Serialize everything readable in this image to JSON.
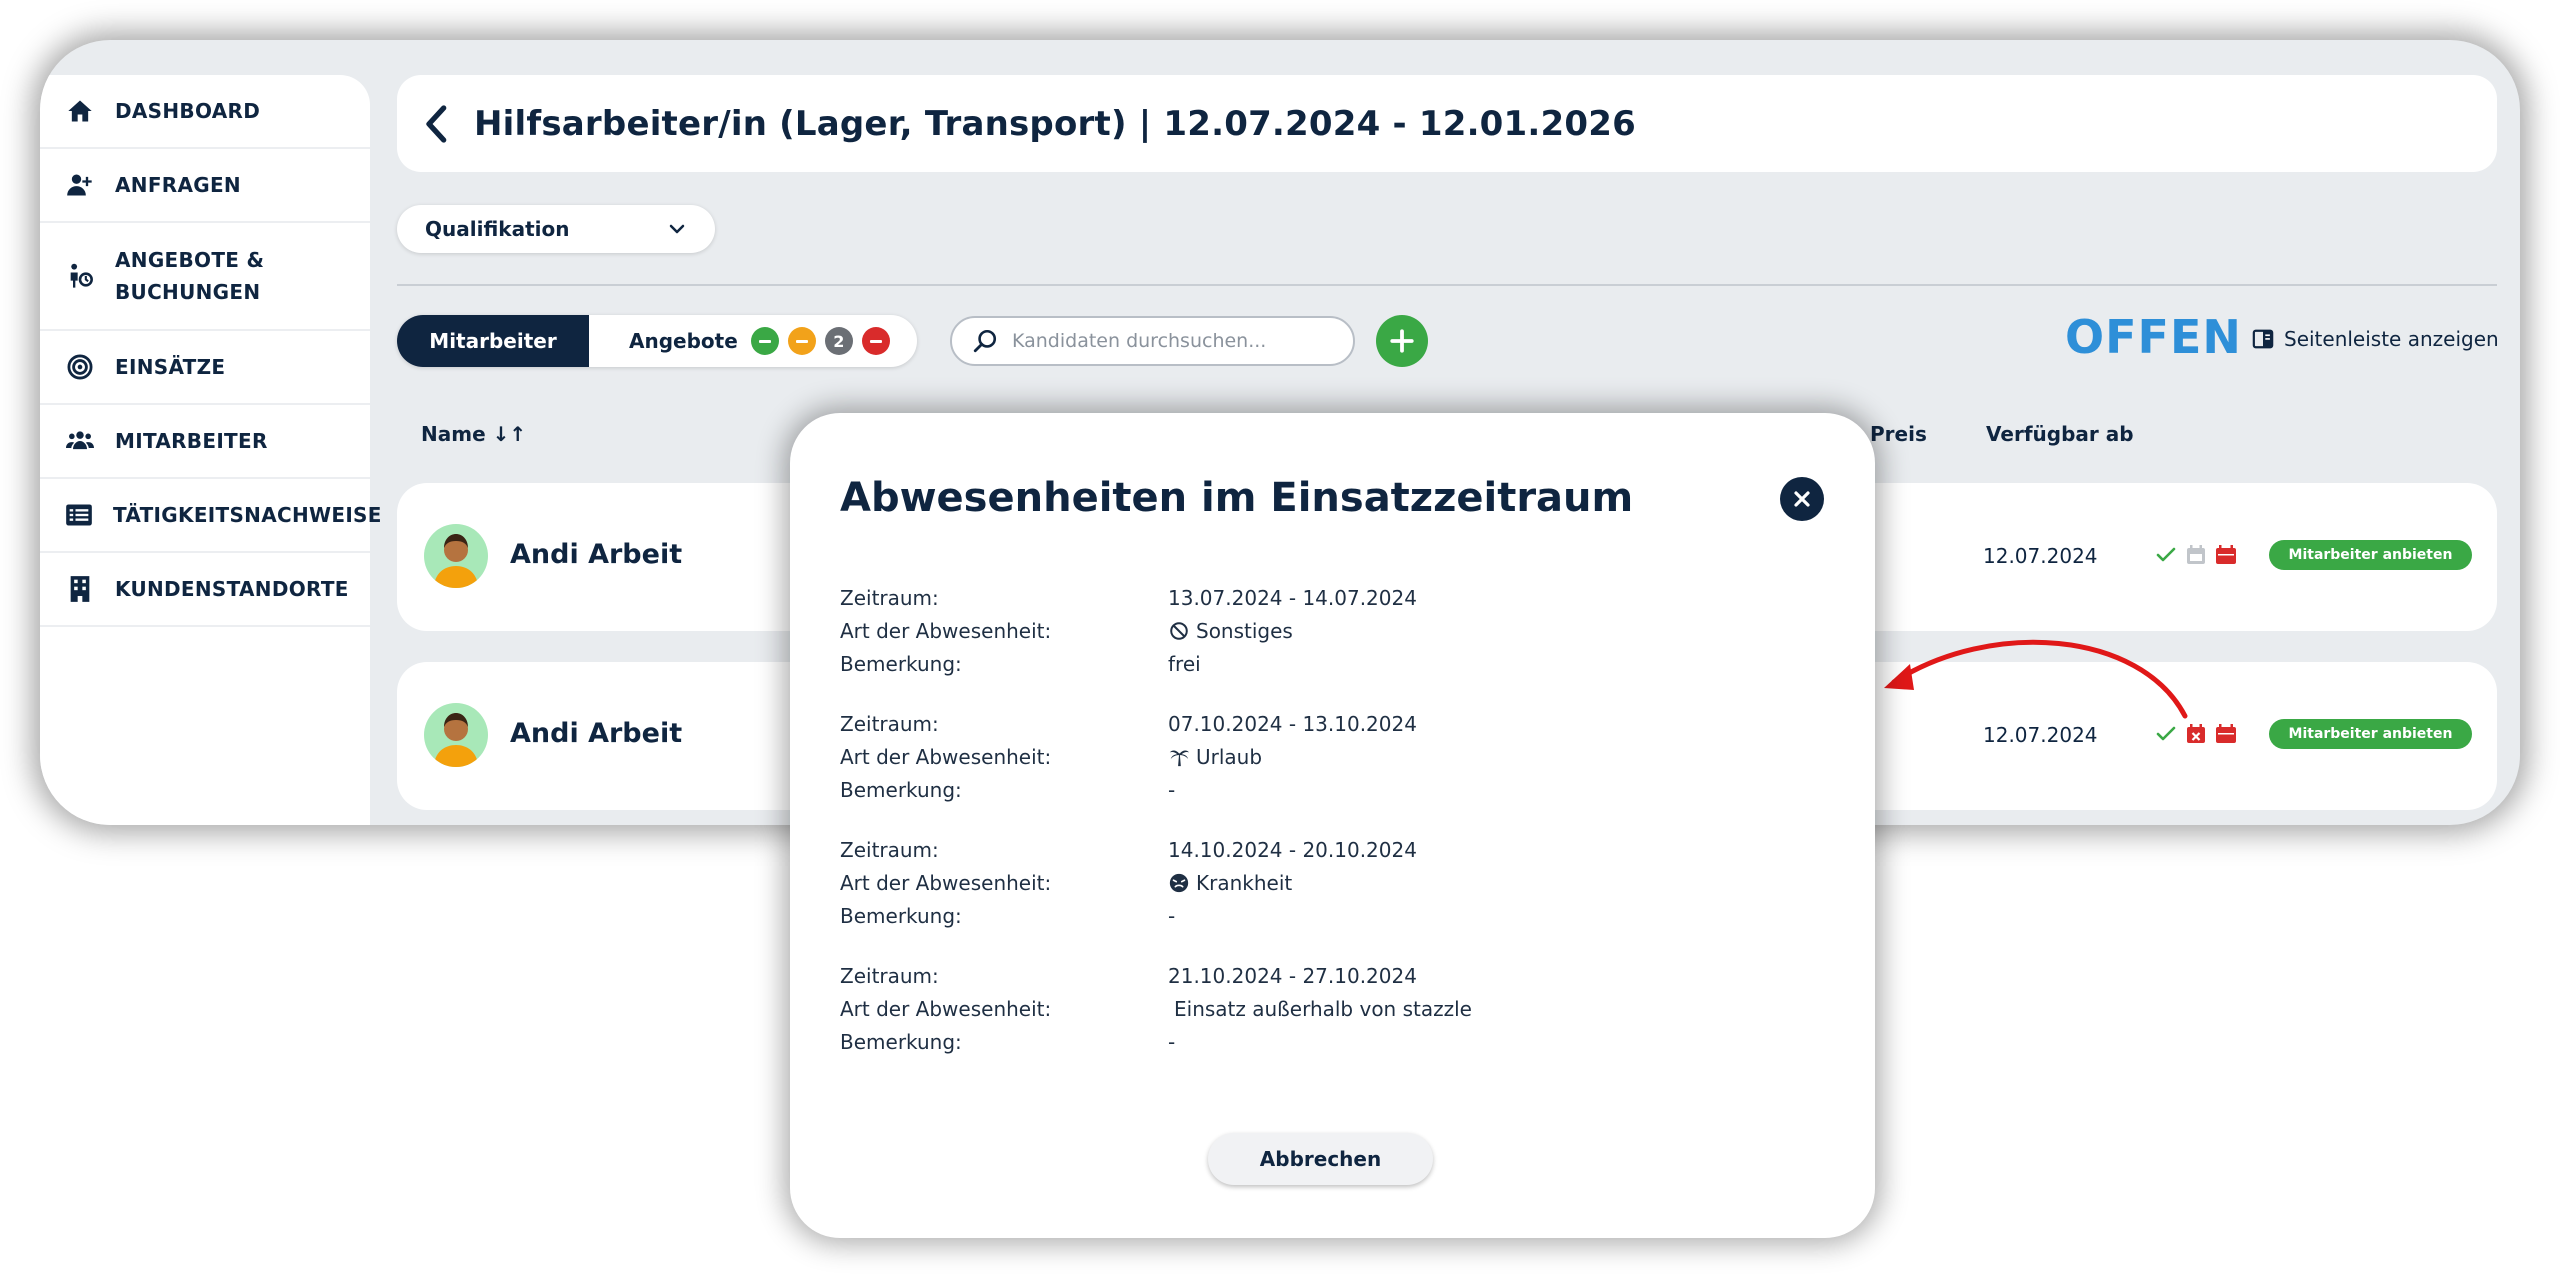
{
  "sidebar": {
    "items": [
      {
        "label": "DASHBOARD",
        "icon": "home-icon"
      },
      {
        "label": "ANFRAGEN",
        "icon": "user-plus-icon"
      },
      {
        "label": "ANGEBOTE &\nBUCHUNGEN",
        "icon": "person-offer-icon"
      },
      {
        "label": "EINSÄTZE",
        "icon": "target-icon"
      },
      {
        "label": "MITARBEITER",
        "icon": "users-icon"
      },
      {
        "label": "TÄTIGKEITSNACHWEISE",
        "icon": "list-icon"
      },
      {
        "label": "KUNDENSTANDORTE",
        "icon": "building-icon"
      }
    ]
  },
  "header": {
    "title": "Hilfsarbeiter/in (Lager, Transport) | 12.07.2024 - 12.01.2026"
  },
  "filter": {
    "qualification_label": "Qualifikation"
  },
  "tabs": {
    "mitarbeiter": "Mitarbeiter",
    "angebote": "Angebote",
    "badges": [
      {
        "color": "#3aa845",
        "value": ""
      },
      {
        "color": "#f2a21a",
        "value": ""
      },
      {
        "color": "#6b6f75",
        "value": "2"
      },
      {
        "color": "#d92b2b",
        "value": ""
      }
    ]
  },
  "search": {
    "placeholder": "Kandidaten durchsuchen...",
    "value": ""
  },
  "status": "OFFEN",
  "sidebar_toggle_label": "Seitenleiste anzeigen",
  "columns": {
    "name": "Name ↓↑",
    "preis": "Preis",
    "available": "Verfügbar ab"
  },
  "candidates": [
    {
      "name": "Andi Arbeit",
      "available": "12.07.2024",
      "action": "Mitarbeiter anbieten"
    },
    {
      "name": "Andi Arbeit",
      "available": "12.07.2024",
      "action": "Mitarbeiter anbieten"
    }
  ],
  "colors": {
    "primary": "#0f2540",
    "accent_green": "#3aa845",
    "status_blue": "#2e8fd8",
    "alert_red": "#d92b2b"
  },
  "modal": {
    "title": "Abwesenheiten im Einsatzzeitraum",
    "labels": {
      "period": "Zeitraum:",
      "type": "Art der Abwesenheit:",
      "note": "Bemerkung:"
    },
    "absences": [
      {
        "period": "13.07.2024 - 14.07.2024",
        "type": "Sonstiges",
        "icon": "ban-icon",
        "note": "frei"
      },
      {
        "period": "07.10.2024 - 13.10.2024",
        "type": "Urlaub",
        "icon": "palm-tree-icon",
        "note": "-"
      },
      {
        "period": "14.10.2024 - 20.10.2024",
        "type": "Krankheit",
        "icon": "sick-face-icon",
        "note": "-"
      },
      {
        "period": "21.10.2024 - 27.10.2024",
        "type": "Einsatz außerhalb von stazzle",
        "icon": "",
        "note": "-"
      }
    ],
    "cancel_label": "Abbrechen"
  }
}
